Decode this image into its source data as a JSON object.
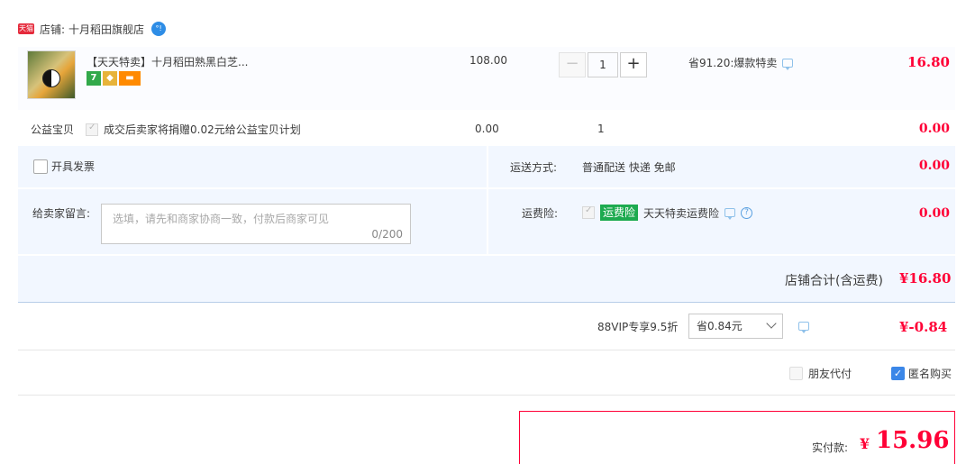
{
  "store": {
    "badge": "天猫",
    "label": "店铺:",
    "name": "十月稻田旗舰店",
    "chat_badge": "°!"
  },
  "product": {
    "title": "【天天特卖】十月稻田熟黑白芝...",
    "tag_seven": "7",
    "price": "108.00",
    "quantity": "1",
    "minus_label": "−",
    "plus_label": "+",
    "promo_text": "省91.20:爆款特卖",
    "subtotal": "16.80"
  },
  "charity": {
    "label": "公益宝贝",
    "description": "成交后卖家将捐赠0.02元给公益宝贝计划",
    "price": "0.00",
    "quantity": "1",
    "subtotal": "0.00"
  },
  "invoice": {
    "label": "开具发票"
  },
  "shipping": {
    "label": "运送方式:",
    "value": "普通配送 快递 免邮",
    "amount": "0.00"
  },
  "message": {
    "label": "给卖家留言:",
    "placeholder": "选填，请先和商家协商一致，付款后商家可见",
    "count": "0/200"
  },
  "insurance": {
    "label": "运费险:",
    "tag": "运费险",
    "name": "天天特卖运费险",
    "help": "?",
    "amount": "0.00"
  },
  "store_total": {
    "label": "店铺合计(含运费)",
    "value": "¥16.80"
  },
  "vip": {
    "label": "88VIP专享9.5折",
    "selected_option": "省0.84元",
    "amount": "¥-0.84"
  },
  "options": {
    "friend_pay": "朋友代付",
    "anonymous": "匿名购买",
    "anonymous_mark": "✓"
  },
  "payment": {
    "label": "实付款:",
    "currency": "¥",
    "amount": "15.96"
  },
  "colors": {
    "accent_red": "#ff0036",
    "panel_blue": "#f2f7ff",
    "insurance_green": "#1daa4f",
    "checkbox_blue": "#3b87e8"
  }
}
